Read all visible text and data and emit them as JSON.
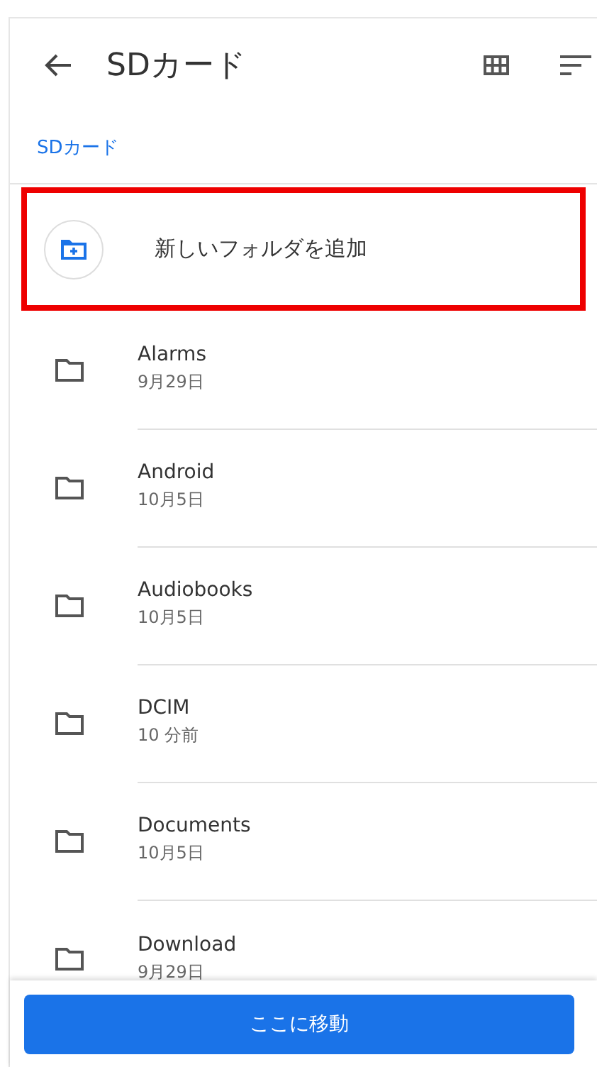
{
  "header": {
    "title": "SDカード"
  },
  "breadcrumb": "SDカード",
  "new_folder": {
    "label": "新しいフォルダを追加",
    "highlighted": true
  },
  "folders": [
    {
      "name": "Alarms",
      "date": "9月29日"
    },
    {
      "name": "Android",
      "date": "10月5日"
    },
    {
      "name": "Audiobooks",
      "date": "10月5日"
    },
    {
      "name": "DCIM",
      "date": "10 分前"
    },
    {
      "name": "Documents",
      "date": "10月5日"
    },
    {
      "name": "Download",
      "date": "9月29日"
    }
  ],
  "action_button": "ここに移動"
}
